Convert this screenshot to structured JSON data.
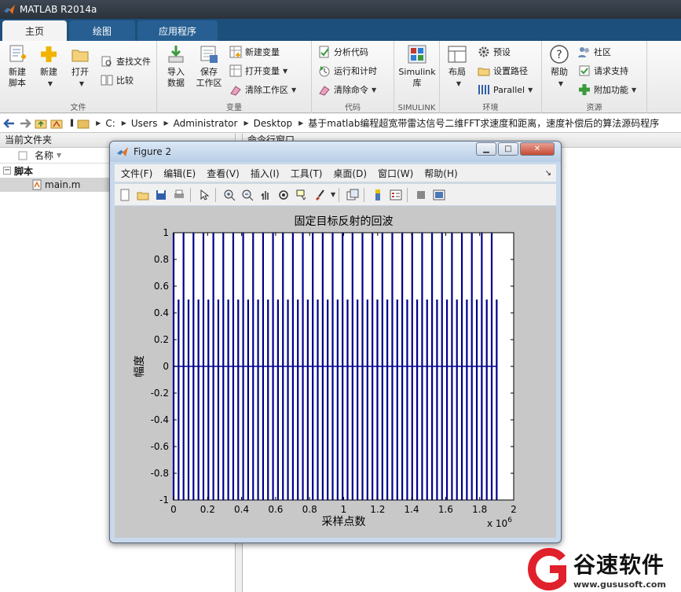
{
  "app": {
    "title": "MATLAB R2014a"
  },
  "tabs": [
    {
      "label": "主页",
      "active": true
    },
    {
      "label": "绘图",
      "active": false
    },
    {
      "label": "应用程序",
      "active": false
    }
  ],
  "ribbon": {
    "file": {
      "label": "文件",
      "new_script": "新建\n脚本",
      "new": "新建",
      "open": "打开",
      "find_files": "查找文件",
      "compare": "比较"
    },
    "variable": {
      "label": "变量",
      "import": "导入\n数据",
      "save_ws": "保存\n工作区",
      "new_var": "新建变量",
      "open_var": "打开变量",
      "clear_ws": "清除工作区"
    },
    "code": {
      "label": "代码",
      "analyze": "分析代码",
      "run_time": "运行和计时",
      "clear_cmd": "清除命令"
    },
    "simulink": {
      "label": "SIMULINK",
      "btn": "Simulink\n库"
    },
    "env": {
      "label": "环境",
      "layout": "布局",
      "prefs": "预设",
      "set_path": "设置路径",
      "parallel": "Parallel"
    },
    "resources": {
      "label": "资源",
      "help": "帮助",
      "community": "社区",
      "support": "请求支持",
      "addons": "附加功能"
    }
  },
  "address": {
    "crumbs": [
      "C:",
      "Users",
      "Administrator",
      "Desktop",
      "基于matlab编程超宽带雷达信号二维FFT求速度和距离，速度补偿后的算法源码程序"
    ]
  },
  "left_panel": {
    "title": "当前文件夹",
    "col_name": "名称",
    "folder": "脚本",
    "file": "main.m"
  },
  "right_panel": {
    "title": "命令行窗口"
  },
  "figure": {
    "title": "Figure 2",
    "menu": [
      "文件(F)",
      "编辑(E)",
      "查看(V)",
      "插入(I)",
      "工具(T)",
      "桌面(D)",
      "窗口(W)",
      "帮助(H)"
    ],
    "toolbar_icons": [
      "new-figure-icon",
      "open-file-icon",
      "save-icon",
      "print-icon",
      "pointer-icon",
      "zoom-in-icon",
      "zoom-out-icon",
      "pan-icon",
      "rotate-icon",
      "data-cursor-icon",
      "brush-icon",
      "link-plot-icon",
      "colorbar-icon",
      "legend-icon",
      "hide-tools-icon",
      "show-tools-icon"
    ]
  },
  "chart_data": {
    "type": "line",
    "title": "固定目标反射的回波",
    "xlabel": "采样点数",
    "ylabel": "幅度",
    "x_multiplier": "x 10^6",
    "xlim": [
      0,
      2
    ],
    "ylim": [
      -1,
      1
    ],
    "xticks": [
      "0",
      "0.2",
      "0.4",
      "0.6",
      "0.8",
      "1",
      "1.2",
      "1.4",
      "1.6",
      "1.8",
      "2"
    ],
    "yticks": [
      "1",
      "0.8",
      "0.6",
      "0.4",
      "0.2",
      "0",
      "-0.2",
      "-0.4",
      "-0.6",
      "-0.8",
      "-1"
    ],
    "series": [
      {
        "color": "#00008b",
        "pulse_start": 0.0,
        "pulse_end": 1.9,
        "pulse_values": [
          1,
          0.5,
          1,
          0.5,
          1,
          0.5,
          1,
          0.5,
          1,
          0.5,
          1,
          0.5,
          1,
          0.5,
          1,
          0.5,
          1,
          0.5,
          1,
          0.5,
          1,
          0.5,
          1,
          0.5,
          1,
          0.5,
          1,
          0.5,
          1,
          0.5,
          1,
          0.5,
          1,
          0.5,
          1,
          0.5,
          1,
          0.5,
          1,
          0.5,
          1,
          0.5,
          1,
          0.5,
          1,
          0.5,
          1,
          0.5,
          1,
          0.5,
          1,
          0.5,
          1,
          0.5,
          1,
          0.5,
          1,
          0.5,
          1,
          0.5,
          1,
          0.5,
          1,
          0.5,
          1,
          0.5
        ]
      }
    ]
  },
  "watermark": {
    "text": "谷速软件",
    "url": "www.gususoft.com"
  }
}
